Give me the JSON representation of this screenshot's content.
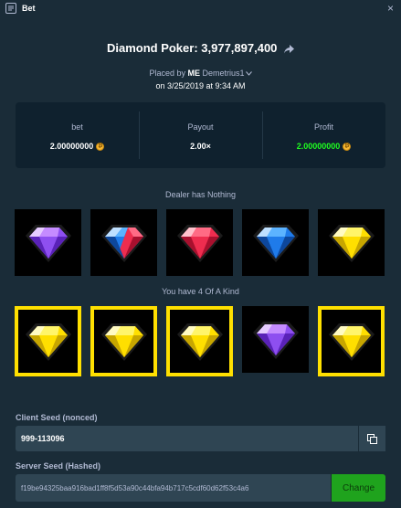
{
  "window": {
    "title": "Bet",
    "close_label": "×"
  },
  "bet": {
    "headline": "Diamond Poker: 3,977,897,400",
    "placed_by_prefix": "Placed by",
    "user_tag": "ME",
    "username": "Demetrius1",
    "date_line": "on 3/25/2019 at 9:34 AM"
  },
  "stats": [
    {
      "label": "bet",
      "value": "2.00000000",
      "coin": true,
      "color": "#ffffff"
    },
    {
      "label": "Payout",
      "value": "2.00×",
      "coin": false,
      "color": "#ffffff"
    },
    {
      "label": "Profit",
      "value": "2.00000000",
      "coin": true,
      "color": "#1fff20"
    }
  ],
  "coin_symbol": "₿",
  "dealer": {
    "label": "Dealer has Nothing",
    "cards": [
      {
        "gem": "purple-gem",
        "highlighted": false
      },
      {
        "gem": "blue-red-gem",
        "highlighted": false
      },
      {
        "gem": "red-gem",
        "highlighted": false
      },
      {
        "gem": "blue-gem",
        "highlighted": false
      },
      {
        "gem": "yellow-gem",
        "highlighted": false
      }
    ]
  },
  "player": {
    "label": "You have 4 Of A Kind",
    "cards": [
      {
        "gem": "yellow-gem",
        "highlighted": true
      },
      {
        "gem": "yellow-gem",
        "highlighted": true
      },
      {
        "gem": "yellow-gem",
        "highlighted": true
      },
      {
        "gem": "purple-gem",
        "highlighted": false
      },
      {
        "gem": "yellow-gem",
        "highlighted": true
      }
    ]
  },
  "seeds": {
    "client_label": "Client Seed (nonced)",
    "client_value": "999-113096",
    "server_label": "Server Seed (Hashed)",
    "server_value": "f19be94325baa916bad1ff8f5d53a90c44bfa94b717c5cdf60d62f53c4a6",
    "change_label": "Change"
  },
  "colors": {
    "background": "#1a2c38",
    "panel": "#0f212e",
    "input": "#2f4553",
    "highlight": "#ffe000",
    "profit": "#1fff20",
    "change_button": "#1fa31d"
  },
  "icons": [
    "bet-icon",
    "share-icon",
    "chevron-down-icon",
    "coin-icon",
    "copy-icon",
    "close-icon"
  ]
}
